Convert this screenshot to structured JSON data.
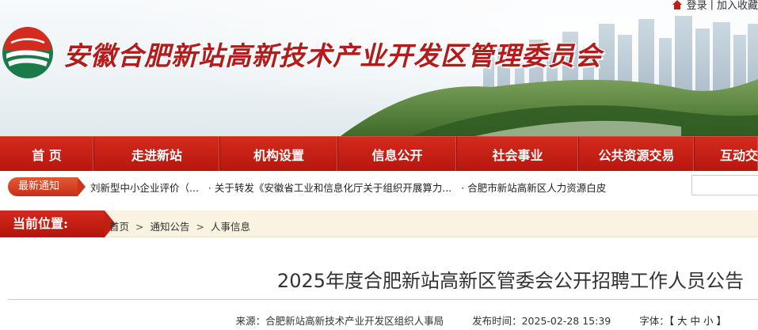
{
  "header": {
    "site_title": "安徽合肥新站高新技术产业开发区管理委员会",
    "top_links": {
      "login": "登录",
      "favorite": "加入收藏"
    }
  },
  "nav": {
    "items": [
      {
        "label": "首  页"
      },
      {
        "label": "走进新站"
      },
      {
        "label": "机构设置"
      },
      {
        "label": "信息公开"
      },
      {
        "label": "社会事业"
      },
      {
        "label": "公共资源交易"
      },
      {
        "label": "互动交"
      }
    ]
  },
  "ticker": {
    "badge": "最新通知",
    "items": [
      "刘新型中小企业评价（...",
      "·  关于转发《安徽省工业和信息化厅关于组织开展算力...",
      "·  合肥市新站高新区人力资源白皮"
    ]
  },
  "breadcrumb": {
    "label": "当前位置:",
    "items": [
      "首页",
      "通知公告",
      "人事信息"
    ],
    "separator": ">"
  },
  "article": {
    "title": "2025年度合肥新站高新区管委会公开招聘工作人员公告",
    "source_label": "来源：",
    "source": "合肥新站高新技术产业开发区组织人事局",
    "date_label": "发布时间：",
    "date": "2025-02-28 15:39",
    "font_label": "字体：",
    "font_open": "【",
    "font_large": "大",
    "font_medium": "中",
    "font_small": "小",
    "font_close": "】"
  },
  "colors": {
    "brand_red": "#c01e12",
    "crumb_bg": "#fbf3e1"
  },
  "icons": {
    "home": "home-icon",
    "logo": "site-logo"
  }
}
